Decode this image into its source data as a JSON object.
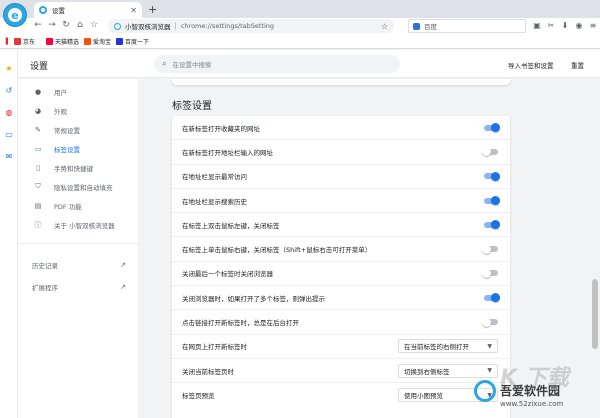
{
  "browser": {
    "tab_title": "设置",
    "new_tab_symbol": "+",
    "app_name": "小智双核浏览器",
    "url": "chrome://settings/tabSetting",
    "search_engine": "百度"
  },
  "bookmarks": [
    {
      "label": "京东",
      "color": "#e4393c"
    },
    {
      "label": "天猫精选",
      "color": "#ff0036"
    },
    {
      "label": "爱淘宝",
      "color": "#ff5000"
    },
    {
      "label": "百度一下",
      "color": "#2932e1"
    }
  ],
  "settings": {
    "title": "设置",
    "search_placeholder": "在设置中搜索",
    "import_link": "导入书签和设置",
    "reset_link": "重置"
  },
  "nav": {
    "items": [
      {
        "label": "用户",
        "icon": "person-icon"
      },
      {
        "label": "外观",
        "icon": "palette-icon"
      },
      {
        "label": "常规设置",
        "icon": "wrench-icon"
      },
      {
        "label": "标签设置",
        "icon": "tab-icon",
        "active": true
      },
      {
        "label": "手势和快捷键",
        "icon": "mouse-icon"
      },
      {
        "label": "隐私设置和自动填充",
        "icon": "shield-icon"
      },
      {
        "label": "PDF 功能",
        "icon": "pdf-icon"
      },
      {
        "label": "关于 小智双核浏览器",
        "icon": "info-icon"
      }
    ],
    "links": [
      {
        "label": "历史记录"
      },
      {
        "label": "扩展程序"
      }
    ]
  },
  "section": {
    "title": "标签设置",
    "rows": [
      {
        "label": "在新标签打开收藏夹的网址",
        "type": "toggle",
        "on": true
      },
      {
        "label": "在新标签打开地址栏输入的网址",
        "type": "toggle",
        "on": false
      },
      {
        "label": "在地址栏显示最常访问",
        "type": "toggle",
        "on": true
      },
      {
        "label": "在地址栏显示搜索历史",
        "type": "toggle",
        "on": true
      },
      {
        "label": "在标签上双击鼠标左键，关闭标签",
        "type": "toggle",
        "on": true
      },
      {
        "label": "在标签上单击鼠标右键，关闭标签（Shift+鼠标右击可打开菜单）",
        "type": "toggle",
        "on": false
      },
      {
        "label": "关闭最后一个标签时关闭浏览器",
        "type": "toggle",
        "on": false
      },
      {
        "label": "关闭浏览器时，如果打开了多个标签，则弹出提示",
        "type": "toggle",
        "on": true
      },
      {
        "label": "点击链接打开新标签时，总是在后台打开",
        "type": "toggle",
        "on": false
      },
      {
        "label": "在网页上打开新标签时",
        "type": "select",
        "value": "在当前标签的右侧打开"
      },
      {
        "label": "关闭当前标签页时",
        "type": "select",
        "value": "切换到右侧标签"
      },
      {
        "label": "标签页预览",
        "type": "select",
        "value": "使用小图预览"
      }
    ]
  },
  "watermark": {
    "big": "K 下载",
    "title": "吾爱软件园",
    "url": "www.52zixue.com"
  },
  "colors": {
    "accent": "#1a73e8",
    "toggle_on_track": "#8ab4f8",
    "toggle_off_track": "#bdc1c6"
  }
}
